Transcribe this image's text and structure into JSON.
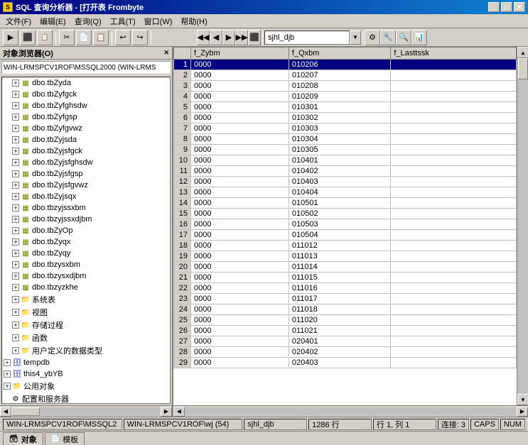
{
  "titleBar": {
    "title": "SQL 查询分析器 - [打开表  Frombyte",
    "icon": "SQL"
  },
  "menuBar": {
    "items": [
      "文件(F)",
      "编辑(E)",
      "查询(Q)",
      "工具(T)",
      "窗口(W)",
      "帮助(H)"
    ]
  },
  "toolbar": {
    "dropdown": "sjhl_djb",
    "buttons": [
      "◀",
      "▶",
      "▶▶",
      "⬛",
      "◀◀"
    ]
  },
  "objectBrowser": {
    "header": "对象浏览器(O)",
    "dropdownValue": "WIN-LRMSPCV1ROF\\MSSQL2000 (WIN-LRMS",
    "treeItems": [
      {
        "label": "dbo.tbZyda",
        "indent": 2,
        "hasExpand": true
      },
      {
        "label": "dbo.tbZyfgck",
        "indent": 2,
        "hasExpand": true
      },
      {
        "label": "dbo.tbZyfghsdw",
        "indent": 2,
        "hasExpand": true
      },
      {
        "label": "dbo.tbZyfgsp",
        "indent": 2,
        "hasExpand": true
      },
      {
        "label": "dbo.tbZyfgvwz",
        "indent": 2,
        "hasExpand": true
      },
      {
        "label": "dbo.tbZyjsda",
        "indent": 2,
        "hasExpand": true
      },
      {
        "label": "dbo.tbZyjsfgck",
        "indent": 2,
        "hasExpand": true
      },
      {
        "label": "dbo.tbZyjsfghsdw",
        "indent": 2,
        "hasExpand": true
      },
      {
        "label": "dbo.tbZyjsfgsp",
        "indent": 2,
        "hasExpand": true
      },
      {
        "label": "dbo.tbZyjsfgvwz",
        "indent": 2,
        "hasExpand": true
      },
      {
        "label": "dbo.tbZyjsqx",
        "indent": 2,
        "hasExpand": true
      },
      {
        "label": "dbo.tbzyjssxbm",
        "indent": 2,
        "hasExpand": true
      },
      {
        "label": "dbo.tbzyjssxdjbm",
        "indent": 2,
        "hasExpand": true
      },
      {
        "label": "dbo.tbZyOp",
        "indent": 2,
        "hasExpand": true
      },
      {
        "label": "dbo.tbZyqx",
        "indent": 2,
        "hasExpand": true
      },
      {
        "label": "dbo.tbZyqy",
        "indent": 2,
        "hasExpand": true
      },
      {
        "label": "dbo.tbzysxbm",
        "indent": 2,
        "hasExpand": true
      },
      {
        "label": "dbo.tbzysxdjbm",
        "indent": 2,
        "hasExpand": true
      },
      {
        "label": "dbo.tbzyzkhe",
        "indent": 2,
        "hasExpand": true
      },
      {
        "label": "系统表",
        "indent": 1,
        "hasExpand": true,
        "isFolder": true
      },
      {
        "label": "视图",
        "indent": 1,
        "hasExpand": true,
        "isFolder": true
      },
      {
        "label": "存储过程",
        "indent": 1,
        "hasExpand": true,
        "isFolder": true
      },
      {
        "label": "函数",
        "indent": 1,
        "hasExpand": true,
        "isFolder": true
      },
      {
        "label": "用户定义的数据类型",
        "indent": 1,
        "hasExpand": true,
        "isFolder": true
      },
      {
        "label": "tempdb",
        "indent": 0,
        "hasExpand": true,
        "isRoot": true
      },
      {
        "label": "this4_ybYB",
        "indent": 0,
        "hasExpand": true,
        "isRoot": true
      },
      {
        "label": "公用对象",
        "indent": 0,
        "hasExpand": true,
        "isRoot": true
      },
      {
        "label": "配置和服务器",
        "indent": 0,
        "hasExpand": false,
        "isRoot": true
      }
    ]
  },
  "dataGrid": {
    "columns": [
      "f_Zybm",
      "f_Qxbm",
      "f_Lasttssk"
    ],
    "selectedRow": 1,
    "rows": [
      [
        1,
        "0000",
        "010206",
        ""
      ],
      [
        2,
        "0000",
        "010207",
        ""
      ],
      [
        3,
        "0000",
        "010208",
        ""
      ],
      [
        4,
        "0000",
        "010209",
        ""
      ],
      [
        5,
        "0000",
        "010301",
        ""
      ],
      [
        6,
        "0000",
        "010302",
        ""
      ],
      [
        7,
        "0000",
        "010303",
        ""
      ],
      [
        8,
        "0000",
        "010304",
        ""
      ],
      [
        9,
        "0000",
        "010305",
        ""
      ],
      [
        10,
        "0000",
        "010401",
        ""
      ],
      [
        11,
        "0000",
        "010402",
        ""
      ],
      [
        12,
        "0000",
        "010403",
        ""
      ],
      [
        13,
        "0000",
        "010404",
        ""
      ],
      [
        14,
        "0000",
        "010501",
        ""
      ],
      [
        15,
        "0000",
        "010502",
        ""
      ],
      [
        16,
        "0000",
        "010503",
        ""
      ],
      [
        17,
        "0000",
        "010504",
        ""
      ],
      [
        18,
        "0000",
        "011012",
        ""
      ],
      [
        19,
        "0000",
        "011013",
        ""
      ],
      [
        20,
        "0000",
        "011014",
        ""
      ],
      [
        21,
        "0000",
        "011015",
        ""
      ],
      [
        22,
        "0000",
        "011016",
        ""
      ],
      [
        23,
        "0000",
        "011017",
        ""
      ],
      [
        24,
        "0000",
        "011018",
        ""
      ],
      [
        25,
        "0000",
        "011020",
        ""
      ],
      [
        26,
        "0000",
        "011021",
        ""
      ],
      [
        27,
        "0000",
        "020401",
        ""
      ],
      [
        28,
        "0000",
        "020402",
        ""
      ],
      [
        29,
        "0000",
        "020403",
        ""
      ]
    ]
  },
  "statusBar": {
    "connection": "WIN-LRMSPCV1ROF\\MSSQL2",
    "database": "WIN-LRMSPCV1ROF\\wj (54)",
    "table": "sjhl_djb",
    "rows": "1286 行",
    "position": "行 1, 列 1",
    "connNum": "连接: 3",
    "caps": "CAPS",
    "num": "NUM"
  },
  "bottomTabs": [
    {
      "label": "对象",
      "active": true
    },
    {
      "label": "模板",
      "active": false
    }
  ]
}
